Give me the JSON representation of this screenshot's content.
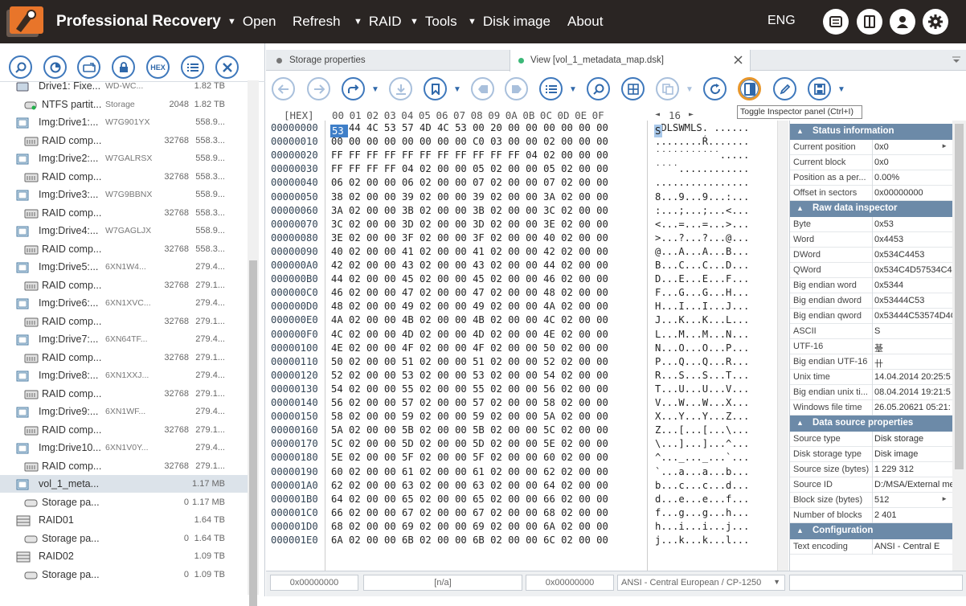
{
  "app": {
    "title": "Professional Recovery",
    "lang": "ENG"
  },
  "menu": [
    {
      "label": "Open",
      "arrow": true
    },
    {
      "label": "Refresh",
      "arrow": false
    },
    {
      "label": "RAID",
      "arrow": true
    },
    {
      "label": "Tools",
      "arrow": true
    },
    {
      "label": "Disk image",
      "arrow": true
    },
    {
      "label": "About",
      "arrow": false
    }
  ],
  "left_tools": {
    "hex_label": "HEX"
  },
  "tree": [
    {
      "name": "Drive1: Fixe...",
      "sub": "WD-WC...",
      "blocks": "",
      "size": "1.82 TB",
      "icon": "drive",
      "indent": 0,
      "partial": true
    },
    {
      "name": "NTFS partit...",
      "sub": "Storage",
      "blocks": "2048",
      "size": "1.82 TB",
      "icon": "partition",
      "indent": 1
    },
    {
      "name": "Img:Drive1:...",
      "sub": "W7G901YX",
      "blocks": "",
      "size": "558.9...",
      "icon": "image",
      "indent": 0
    },
    {
      "name": "RAID comp...",
      "sub": "",
      "blocks": "32768",
      "size": "558.3...",
      "icon": "raid",
      "indent": 1
    },
    {
      "name": "Img:Drive2:...",
      "sub": "W7GALRSX",
      "blocks": "",
      "size": "558.9...",
      "icon": "image",
      "indent": 0
    },
    {
      "name": "RAID comp...",
      "sub": "",
      "blocks": "32768",
      "size": "558.3...",
      "icon": "raid",
      "indent": 1
    },
    {
      "name": "Img:Drive3:...",
      "sub": "W7G9BBNX",
      "blocks": "",
      "size": "558.9...",
      "icon": "image",
      "indent": 0
    },
    {
      "name": "RAID comp...",
      "sub": "",
      "blocks": "32768",
      "size": "558.3...",
      "icon": "raid",
      "indent": 1
    },
    {
      "name": "Img:Drive4:...",
      "sub": "W7GAGLJX",
      "blocks": "",
      "size": "558.9...",
      "icon": "image",
      "indent": 0
    },
    {
      "name": "RAID comp...",
      "sub": "",
      "blocks": "32768",
      "size": "558.3...",
      "icon": "raid",
      "indent": 1
    },
    {
      "name": "Img:Drive5:...",
      "sub": "6XN1W4...",
      "blocks": "",
      "size": "279.4...",
      "icon": "image",
      "indent": 0
    },
    {
      "name": "RAID comp...",
      "sub": "",
      "blocks": "32768",
      "size": "279.1...",
      "icon": "raid",
      "indent": 1
    },
    {
      "name": "Img:Drive6:...",
      "sub": "6XN1XVC...",
      "blocks": "",
      "size": "279.4...",
      "icon": "image",
      "indent": 0
    },
    {
      "name": "RAID comp...",
      "sub": "",
      "blocks": "32768",
      "size": "279.1...",
      "icon": "raid",
      "indent": 1
    },
    {
      "name": "Img:Drive7:...",
      "sub": "6XN64TF...",
      "blocks": "",
      "size": "279.4...",
      "icon": "image",
      "indent": 0
    },
    {
      "name": "RAID comp...",
      "sub": "",
      "blocks": "32768",
      "size": "279.1...",
      "icon": "raid",
      "indent": 1
    },
    {
      "name": "Img:Drive8:...",
      "sub": "6XN1XXJ...",
      "blocks": "",
      "size": "279.4...",
      "icon": "image",
      "indent": 0
    },
    {
      "name": "RAID comp...",
      "sub": "",
      "blocks": "32768",
      "size": "279.1...",
      "icon": "raid",
      "indent": 1
    },
    {
      "name": "Img:Drive9:...",
      "sub": "6XN1WF...",
      "blocks": "",
      "size": "279.4...",
      "icon": "image",
      "indent": 0
    },
    {
      "name": "RAID comp...",
      "sub": "",
      "blocks": "32768",
      "size": "279.1...",
      "icon": "raid",
      "indent": 1
    },
    {
      "name": "Img:Drive10...",
      "sub": "6XN1V0Y...",
      "blocks": "",
      "size": "279.4...",
      "icon": "image",
      "indent": 0
    },
    {
      "name": "RAID comp...",
      "sub": "",
      "blocks": "32768",
      "size": "279.1...",
      "icon": "raid",
      "indent": 1
    },
    {
      "name": "vol_1_meta...",
      "sub": "",
      "blocks": "",
      "size": "1.17 MB",
      "icon": "image",
      "indent": 0,
      "selected": true
    },
    {
      "name": "Storage pa...",
      "sub": "",
      "blocks": "0",
      "size": "1.17 MB",
      "icon": "storage",
      "indent": 1
    },
    {
      "name": "RAID01",
      "sub": "",
      "blocks": "",
      "size": "1.64 TB",
      "icon": "raidset",
      "indent": 0
    },
    {
      "name": "Storage pa...",
      "sub": "",
      "blocks": "0",
      "size": "1.64 TB",
      "icon": "storage",
      "indent": 1
    },
    {
      "name": "RAID02",
      "sub": "",
      "blocks": "",
      "size": "1.09 TB",
      "icon": "raidset",
      "indent": 0
    },
    {
      "name": "Storage pa...",
      "sub": "",
      "blocks": "0",
      "size": "1.09 TB",
      "icon": "storage",
      "indent": 1
    }
  ],
  "tabs": [
    {
      "label": "Storage properties",
      "active": false,
      "dot_color": "#777777"
    },
    {
      "label": "View [vol_1_metadata_map.dsk]",
      "active": true,
      "dot_color": "#3cb878"
    }
  ],
  "tooltip": "Toggle Inspector panel (Ctrl+I)",
  "hex_header": {
    "tag": "[HEX]",
    "columns": "00 01 02 03 04 05 06 07 08 09 0A 0B 0C 0D 0E 0F",
    "page": "16"
  },
  "hex_rows": [
    {
      "off": "00000000",
      "hex": "   44 4C 53 57 4D 4C 53 00 20 00 00 00 00 00 00",
      "asc": " DLSWMLS. ......"
    },
    {
      "off": "00000010",
      "hex": "00 00 00 00 00 00 00 00 C0 03 00 00 02 00 00 00",
      "asc": "........Ŕ......."
    },
    {
      "off": "00000020",
      "hex": "FF FF FF FF FF FF FF FF FF FF FF 04 02 00 00 00",
      "asc": "˙˙˙˙˙˙˙˙˙˙˙....."
    },
    {
      "off": "00000030",
      "hex": "FF FF FF FF 04 02 00 00 05 02 00 00 05 02 00 00",
      "asc": "˙˙˙˙............"
    },
    {
      "off": "00000040",
      "hex": "06 02 00 00 06 02 00 00 07 02 00 00 07 02 00 00",
      "asc": "................"
    },
    {
      "off": "00000050",
      "hex": "38 02 00 00 39 02 00 00 39 02 00 00 3A 02 00 00",
      "asc": "8...9...9...:..."
    },
    {
      "off": "00000060",
      "hex": "3A 02 00 00 3B 02 00 00 3B 02 00 00 3C 02 00 00",
      "asc": ":...;...;...<..."
    },
    {
      "off": "00000070",
      "hex": "3C 02 00 00 3D 02 00 00 3D 02 00 00 3E 02 00 00",
      "asc": "<...=...=...>..."
    },
    {
      "off": "00000080",
      "hex": "3E 02 00 00 3F 02 00 00 3F 02 00 00 40 02 00 00",
      "asc": ">...?...?...@..."
    },
    {
      "off": "00000090",
      "hex": "40 02 00 00 41 02 00 00 41 02 00 00 42 02 00 00",
      "asc": "@...A...A...B..."
    },
    {
      "off": "000000A0",
      "hex": "42 02 00 00 43 02 00 00 43 02 00 00 44 02 00 00",
      "asc": "B...C...C...D..."
    },
    {
      "off": "000000B0",
      "hex": "44 02 00 00 45 02 00 00 45 02 00 00 46 02 00 00",
      "asc": "D...E...E...F..."
    },
    {
      "off": "000000C0",
      "hex": "46 02 00 00 47 02 00 00 47 02 00 00 48 02 00 00",
      "asc": "F...G...G...H..."
    },
    {
      "off": "000000D0",
      "hex": "48 02 00 00 49 02 00 00 49 02 00 00 4A 02 00 00",
      "asc": "H...I...I...J..."
    },
    {
      "off": "000000E0",
      "hex": "4A 02 00 00 4B 02 00 00 4B 02 00 00 4C 02 00 00",
      "asc": "J...K...K...L..."
    },
    {
      "off": "000000F0",
      "hex": "4C 02 00 00 4D 02 00 00 4D 02 00 00 4E 02 00 00",
      "asc": "L...M...M...N..."
    },
    {
      "off": "00000100",
      "hex": "4E 02 00 00 4F 02 00 00 4F 02 00 00 50 02 00 00",
      "asc": "N...O...O...P..."
    },
    {
      "off": "00000110",
      "hex": "50 02 00 00 51 02 00 00 51 02 00 00 52 02 00 00",
      "asc": "P...Q...Q...R..."
    },
    {
      "off": "00000120",
      "hex": "52 02 00 00 53 02 00 00 53 02 00 00 54 02 00 00",
      "asc": "R...S...S...T..."
    },
    {
      "off": "00000130",
      "hex": "54 02 00 00 55 02 00 00 55 02 00 00 56 02 00 00",
      "asc": "T...U...U...V..."
    },
    {
      "off": "00000140",
      "hex": "56 02 00 00 57 02 00 00 57 02 00 00 58 02 00 00",
      "asc": "V...W...W...X..."
    },
    {
      "off": "00000150",
      "hex": "58 02 00 00 59 02 00 00 59 02 00 00 5A 02 00 00",
      "asc": "X...Y...Y...Z..."
    },
    {
      "off": "00000160",
      "hex": "5A 02 00 00 5B 02 00 00 5B 02 00 00 5C 02 00 00",
      "asc": "Z...[...[...\\..."
    },
    {
      "off": "00000170",
      "hex": "5C 02 00 00 5D 02 00 00 5D 02 00 00 5E 02 00 00",
      "asc": "\\...]...]...^..."
    },
    {
      "off": "00000180",
      "hex": "5E 02 00 00 5F 02 00 00 5F 02 00 00 60 02 00 00",
      "asc": "^..._..._...`..."
    },
    {
      "off": "00000190",
      "hex": "60 02 00 00 61 02 00 00 61 02 00 00 62 02 00 00",
      "asc": "`...a...a...b..."
    },
    {
      "off": "000001A0",
      "hex": "62 02 00 00 63 02 00 00 63 02 00 00 64 02 00 00",
      "asc": "b...c...c...d..."
    },
    {
      "off": "000001B0",
      "hex": "64 02 00 00 65 02 00 00 65 02 00 00 66 02 00 00",
      "asc": "d...e...e...f..."
    },
    {
      "off": "000001C0",
      "hex": "66 02 00 00 67 02 00 00 67 02 00 00 68 02 00 00",
      "asc": "f...g...g...h..."
    },
    {
      "off": "000001D0",
      "hex": "68 02 00 00 69 02 00 00 69 02 00 00 6A 02 00 00",
      "asc": "h...i...i...j..."
    },
    {
      "off": "000001E0",
      "hex": "6A 02 00 00 6B 02 00 00 6B 02 00 00 6C 02 00 00",
      "asc": "j...k...k...l..."
    }
  ],
  "selected": {
    "hex": "53",
    "ascii": "S"
  },
  "inspector": [
    {
      "type": "header",
      "label": "Status information"
    },
    {
      "type": "row",
      "key": "Current position",
      "value": "0x0",
      "expand": true
    },
    {
      "type": "row",
      "key": "Current block",
      "value": "0x0"
    },
    {
      "type": "row",
      "key": "Position as a per...",
      "value": "0.00%"
    },
    {
      "type": "row",
      "key": "Offset in sectors",
      "value": "0x00000000"
    },
    {
      "type": "header",
      "label": "Raw data inspector"
    },
    {
      "type": "row",
      "key": "Byte",
      "value": "0x53"
    },
    {
      "type": "row",
      "key": "Word",
      "value": "0x4453"
    },
    {
      "type": "row",
      "key": "DWord",
      "value": "0x534C4453"
    },
    {
      "type": "row",
      "key": "QWord",
      "value": "0x534C4D57534C4"
    },
    {
      "type": "row",
      "key": "Big endian word",
      "value": "0x5344"
    },
    {
      "type": "row",
      "key": "Big endian dword",
      "value": "0x53444C53"
    },
    {
      "type": "row",
      "key": "Big endian qword",
      "value": "0x53444C53574D4C"
    },
    {
      "type": "row",
      "key": "ASCII",
      "value": "S"
    },
    {
      "type": "row",
      "key": "UTF-16",
      "value": "䑓"
    },
    {
      "type": "row",
      "key": "Big endian UTF-16",
      "value": "卄"
    },
    {
      "type": "row",
      "key": "Unix time",
      "value": "14.04.2014 20:25:5"
    },
    {
      "type": "row",
      "key": "Big endian unix ti...",
      "value": "08.04.2014 19:21:5"
    },
    {
      "type": "row",
      "key": "Windows file time",
      "value": "26.05.20621 05:21:"
    },
    {
      "type": "header",
      "label": "Data source properties"
    },
    {
      "type": "row",
      "key": "Source type",
      "value": "Disk storage"
    },
    {
      "type": "row",
      "key": "Disk storage type",
      "value": "Disk image"
    },
    {
      "type": "row",
      "key": "Source size (bytes)",
      "value": "1 229 312"
    },
    {
      "type": "row",
      "key": "Source ID",
      "value": "D:/MSA/External me"
    },
    {
      "type": "row",
      "key": "Block size (bytes)",
      "value": "512",
      "expand": true
    },
    {
      "type": "row",
      "key": "Number of blocks",
      "value": "2 401"
    },
    {
      "type": "header",
      "label": "Configuration"
    },
    {
      "type": "row",
      "key": "Text encoding",
      "value": "ANSI - Central E"
    }
  ],
  "statusbar": {
    "pos": "0x00000000",
    "sel": "[n/a]",
    "off": "0x00000000",
    "encoding": "ANSI - Central European / CP-1250"
  },
  "colors": {
    "accent": "#3e78bc",
    "header": "#6c8aa8",
    "topbar": "#2a2523",
    "logo": "#e8752a"
  }
}
